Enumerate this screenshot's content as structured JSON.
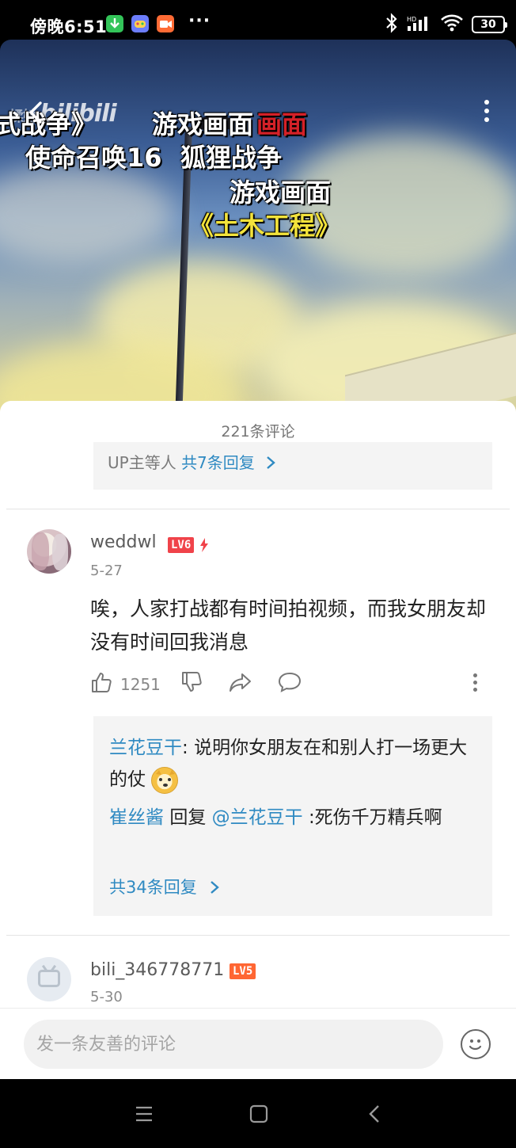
{
  "status_bar": {
    "time": "傍晚6:51",
    "overflow": "···",
    "battery": "30",
    "apps": [
      {
        "name": "download-app-icon",
        "color": "#33c459"
      },
      {
        "name": "game-app-icon",
        "color": "#6c7dfb"
      },
      {
        "name": "video-app-icon",
        "color": "#ff6b35"
      }
    ]
  },
  "video": {
    "logo_prefix": "揉她",
    "logo": "bilibili",
    "subtitles": [
      {
        "text": "式战争》",
        "color": "#ffffff"
      },
      {
        "text": "游戏画面",
        "color": "#ffffff"
      },
      {
        "text": "画面",
        "color": "#d42128"
      },
      {
        "text": "使命召唤16",
        "color": "#ffffff"
      },
      {
        "text": "狐狸战争",
        "color": "#ffffff"
      },
      {
        "text": "游戏画面",
        "color": "#ffffff"
      },
      {
        "text": "《土木工程》",
        "color": "#f3e33b"
      }
    ]
  },
  "comments_panel": {
    "title": "221条评论",
    "prev_reply": {
      "authors": "UP主等人",
      "count_link": "共7条回复"
    },
    "comment": {
      "username": "weddwl",
      "level": "LV6",
      "date": "5-27",
      "text": "唉，人家打战都有时间拍视频，而我女朋友却没有时间回我消息",
      "likes": "1251",
      "replies": [
        {
          "author": "兰花豆干",
          "sep": ": ",
          "text": "说明你女朋友在和别人打一场更大的仗"
        },
        {
          "author": "崔丝酱",
          "verb": "回复",
          "mention": "@兰花豆干",
          "text": ":死伤千万精兵啊"
        }
      ],
      "more_replies": "共34条回复"
    },
    "next_comment": {
      "username": "bili_346778771",
      "level": "LV5",
      "date": "5-30"
    },
    "input": {
      "placeholder": "发一条友善的评论"
    }
  },
  "colors": {
    "accent": "#2f8ac2",
    "level_badge": "#ff6633",
    "level_badge_lv6": "#f0434a"
  }
}
